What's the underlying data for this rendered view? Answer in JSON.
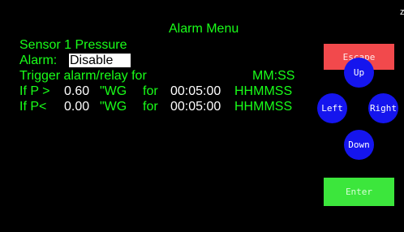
{
  "title": "Alarm Menu",
  "corner_mark": "z",
  "sensor_label": "Sensor 1 Pressure",
  "alarm": {
    "label": "Alarm:",
    "value": "Disable"
  },
  "trigger": {
    "label": "Trigger alarm/relay for",
    "format": "MM:SS"
  },
  "rows": [
    {
      "condition": "If P >",
      "value": "0.60",
      "unit": "\"WG",
      "for": "for",
      "time": "00:05:00",
      "format": "HHMMSS"
    },
    {
      "condition": "If P<",
      "value": "0.00",
      "unit": "\"WG",
      "for": "for",
      "time": "00:05:00",
      "format": "HHMMSS"
    }
  ],
  "buttons": {
    "escape": "Escape",
    "up": "Up",
    "left": "Left",
    "right": "Right",
    "down": "Down",
    "enter": "Enter"
  },
  "colors": {
    "background": "#000000",
    "text_green": "#19ff19",
    "escape": "#f2494c",
    "enter": "#3ce63c",
    "nav": "#1515ee"
  }
}
